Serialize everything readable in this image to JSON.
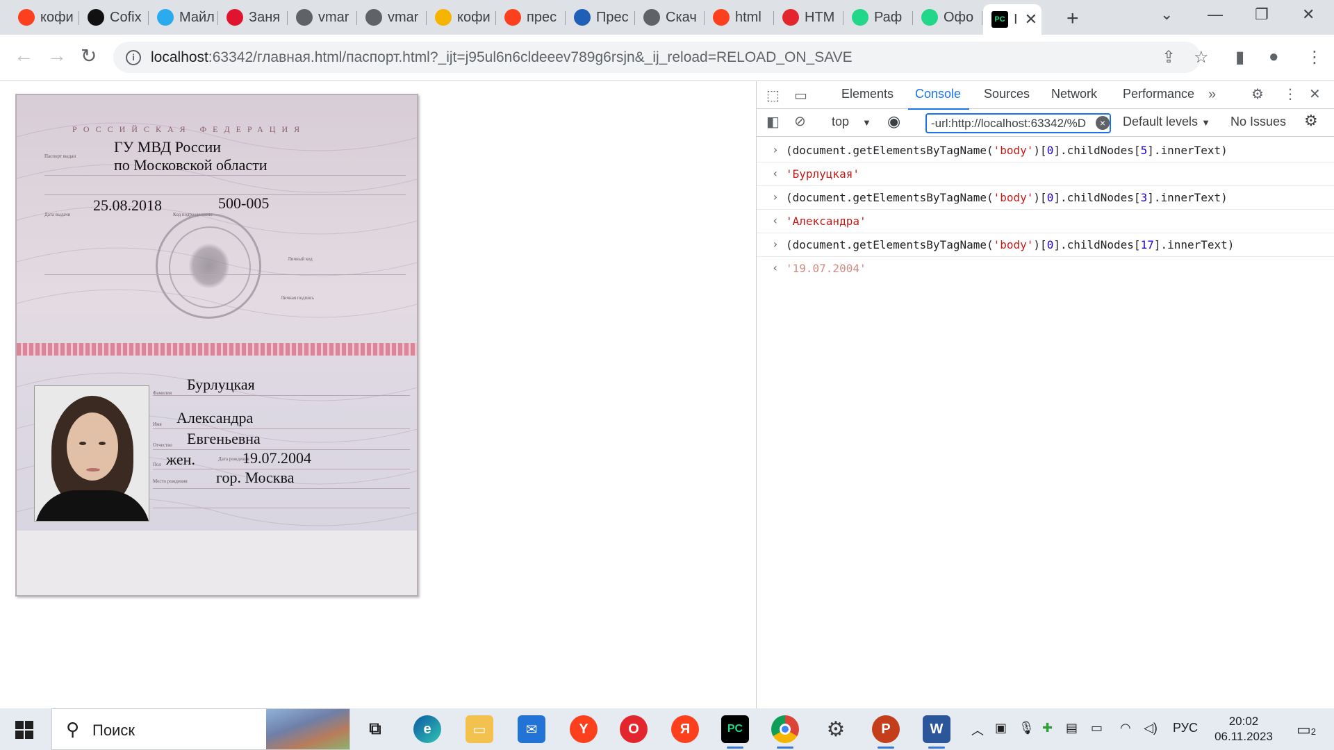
{
  "browser": {
    "tabs": [
      {
        "label": "кофи",
        "icon": "yandex-icon",
        "color": "#fc3f1d"
      },
      {
        "label": "Cofix",
        "icon": "cofix-icon",
        "color": "#111111"
      },
      {
        "label": "Майл",
        "icon": "telegram-icon",
        "color": "#2aabee"
      },
      {
        "label": "Заня",
        "icon": "lms-icon",
        "color": "#e0142e"
      },
      {
        "label": "vmar",
        "icon": "globe-icon",
        "color": "#5f6368"
      },
      {
        "label": "vmar",
        "icon": "globe-icon",
        "color": "#5f6368"
      },
      {
        "label": "кофи",
        "icon": "image-icon",
        "color": "#f4b400"
      },
      {
        "label": "прес",
        "icon": "yandex-icon",
        "color": "#fc3f1d"
      },
      {
        "label": "Прес",
        "icon": "power-icon",
        "color": "#1f5fb8"
      },
      {
        "label": "Скач",
        "icon": "globe-icon",
        "color": "#5f6368"
      },
      {
        "label": "html",
        "icon": "yandex-icon",
        "color": "#fc3f1d"
      },
      {
        "label": "HTM",
        "icon": "opera-icon",
        "color": "#e3262e"
      },
      {
        "label": "Раф",
        "icon": "pycharm-icon",
        "color": "#21d789"
      },
      {
        "label": "Офо",
        "icon": "pycharm-icon",
        "color": "#21d789"
      }
    ],
    "active_tab": {
      "label": "I",
      "icon": "pycharm-icon",
      "close": "✕"
    },
    "new_tab": "+",
    "address": {
      "host": "localhost",
      "path": ":63342/главная.html/паспорт.html?_ijt=j95ul6n6cldeeev789g6rsjn&_ij_reload=RELOAD_ON_SAVE"
    }
  },
  "passport": {
    "header": "РОССИЙСКАЯ ФЕДЕРАЦИЯ",
    "issued_by_line1": "ГУ МВД России",
    "issued_by_line2": "по Московской области",
    "issue_date": "25.08.2018",
    "department_code": "500-005",
    "surname": "Бурлуцкая",
    "name": "Александра",
    "patronymic": "Евгеньевна",
    "sex": "жен.",
    "birth_date": "19.07.2004",
    "birth_place": "гор. Москва",
    "small_labels": {
      "issued_by": "Паспорт выдан",
      "issue_date": "Дата выдачи",
      "code": "Код подразделения",
      "personal_code": "Личный код",
      "signature": "Личная подпись",
      "surname": "Фамилия",
      "name": "Имя",
      "patronymic": "Отчество",
      "sex": "Пол",
      "birth_date": "Дата рождения",
      "birth_place": "Место рождения"
    }
  },
  "devtools": {
    "tabs": [
      "Elements",
      "Console",
      "Sources",
      "Network",
      "Performance"
    ],
    "active_tab": "Console",
    "context": "top",
    "filter": "-url:http://localhost:63342/%D",
    "levels": "Default levels",
    "issues": "No Issues",
    "entries": [
      {
        "kind": "input",
        "prefix": "(document.getElementsByTagName(",
        "arg": "'body'",
        "mid": ")[",
        "index0": "0",
        "tail1": "].childNodes[",
        "index": "5",
        "tail2": "].innerText)"
      },
      {
        "kind": "output",
        "text": "'Бурлуцкая'"
      },
      {
        "kind": "input",
        "prefix": "(document.getElementsByTagName(",
        "arg": "'body'",
        "mid": ")[",
        "index0": "0",
        "tail1": "].childNodes[",
        "index": "3",
        "tail2": "].innerText)"
      },
      {
        "kind": "output",
        "text": "'Александра'"
      },
      {
        "kind": "input",
        "prefix": "(document.getElementsByTagName(",
        "arg": "'body'",
        "mid": ")[",
        "index0": "0",
        "tail1": "].childNodes[",
        "index": "17",
        "tail2": "].innerText)"
      },
      {
        "kind": "preview",
        "text": "'19.07.2004'"
      }
    ]
  },
  "taskbar": {
    "search_placeholder": "Поиск",
    "apps": [
      "task-view",
      "edge",
      "explorer",
      "mail",
      "yandex-browser",
      "opera",
      "yandex",
      "pycharm",
      "chrome",
      "settings",
      "powerpoint",
      "word"
    ],
    "language": "РУС",
    "time": "20:02",
    "date": "06.11.2023",
    "notification_count": "2"
  }
}
